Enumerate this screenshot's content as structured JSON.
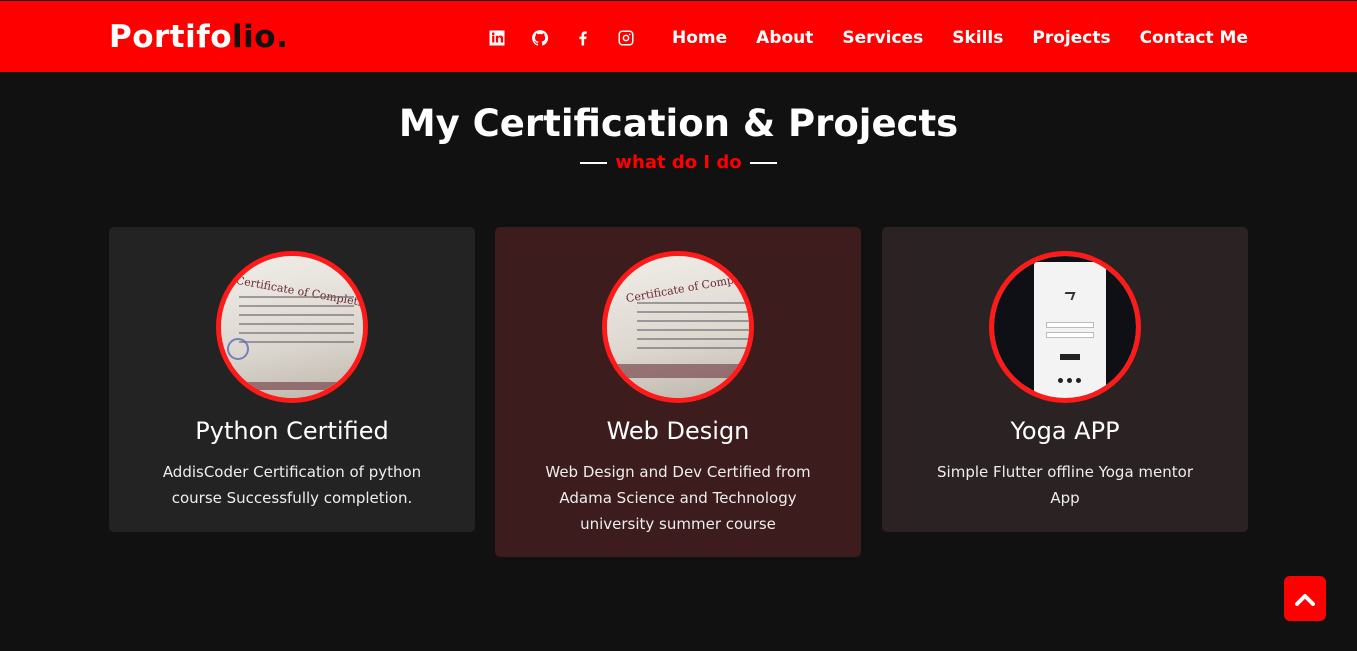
{
  "navbar": {
    "logo_part1": "Portifo",
    "logo_part2": "lio.",
    "social_icons": [
      "linkedin-icon",
      "github-icon",
      "facebook-icon",
      "instagram-icon"
    ],
    "menu": [
      "Home",
      "About",
      "Services",
      "Skills",
      "Projects",
      "Contact Me"
    ]
  },
  "section": {
    "title": "My Certification & Projects",
    "subtitle": "what do I do"
  },
  "cards": [
    {
      "title": "Python Certified",
      "description": "AddisCoder Certification of python course Successfully completion."
    },
    {
      "title": "Web Design",
      "description": "Web Design and Dev Certified from Adama Science and Technology university summer course"
    },
    {
      "title": "Yoga APP",
      "description": "Simple Flutter offline Yoga mentor App"
    }
  ],
  "colors": {
    "accent": "#ff0000",
    "background": "#111111"
  },
  "scroll_top_icon": "chevron-up-icon"
}
